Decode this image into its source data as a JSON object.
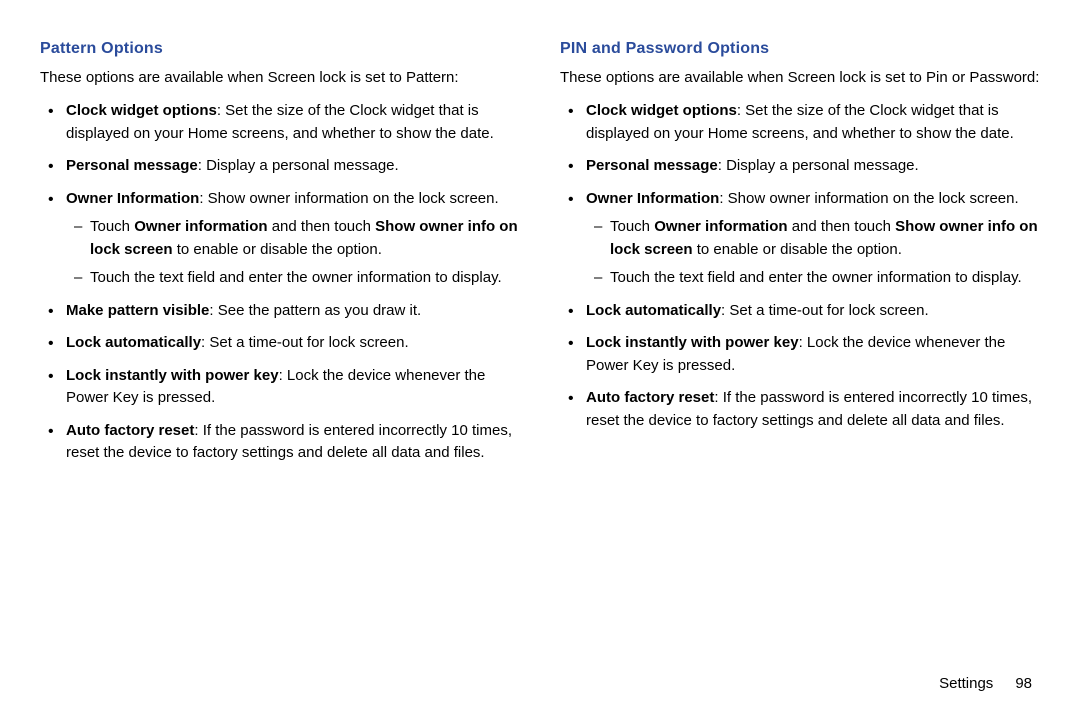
{
  "left": {
    "heading": "Pattern Options",
    "intro": "These options are available when Screen lock is set to Pattern:",
    "items": [
      {
        "label": "Clock widget options",
        "text": ": Set the size of the Clock widget that is displayed on your Home screens, and whether to show the date."
      },
      {
        "label": "Personal message",
        "text": ": Display a personal message."
      },
      {
        "label": "Owner Information",
        "text": ": Show owner information on the lock screen.",
        "sub": [
          {
            "pre": "Touch ",
            "b1": "Owner information",
            "mid": " and then touch ",
            "b2": "Show owner info on lock screen",
            "post": " to enable or disable the option."
          },
          {
            "pre": "Touch the text field and enter the owner information to display."
          }
        ]
      },
      {
        "label": "Make pattern visible",
        "text": ": See the pattern as you draw it."
      },
      {
        "label": "Lock automatically",
        "text": ": Set a time-out for lock screen."
      },
      {
        "label": "Lock instantly with power key",
        "text": ": Lock the device whenever the Power Key is pressed."
      },
      {
        "label": "Auto factory reset",
        "text": ": If the password is entered incorrectly 10 times, reset the device to factory settings and delete all data and files."
      }
    ]
  },
  "right": {
    "heading": "PIN and Password Options",
    "intro": "These options are available when Screen lock is set to Pin or Password:",
    "items": [
      {
        "label": "Clock widget options",
        "text": ": Set the size of the Clock widget that is displayed on your Home screens, and whether to show the date."
      },
      {
        "label": "Personal message",
        "text": ": Display a personal message."
      },
      {
        "label": "Owner Information",
        "text": ": Show owner information on the lock screen.",
        "sub": [
          {
            "pre": "Touch ",
            "b1": "Owner information",
            "mid": " and then touch ",
            "b2": "Show owner info on lock screen",
            "post": " to enable or disable the option."
          },
          {
            "pre": "Touch the text field and enter the owner information to display."
          }
        ]
      },
      {
        "label": "Lock automatically",
        "text": ": Set a time-out for lock screen."
      },
      {
        "label": "Lock instantly with power key",
        "text": ": Lock the device whenever the Power Key is pressed."
      },
      {
        "label": "Auto factory reset",
        "text": ": If the password is entered incorrectly 10 times, reset the device to factory settings and delete all data and files."
      }
    ]
  },
  "footer": {
    "section": "Settings",
    "page": "98"
  }
}
